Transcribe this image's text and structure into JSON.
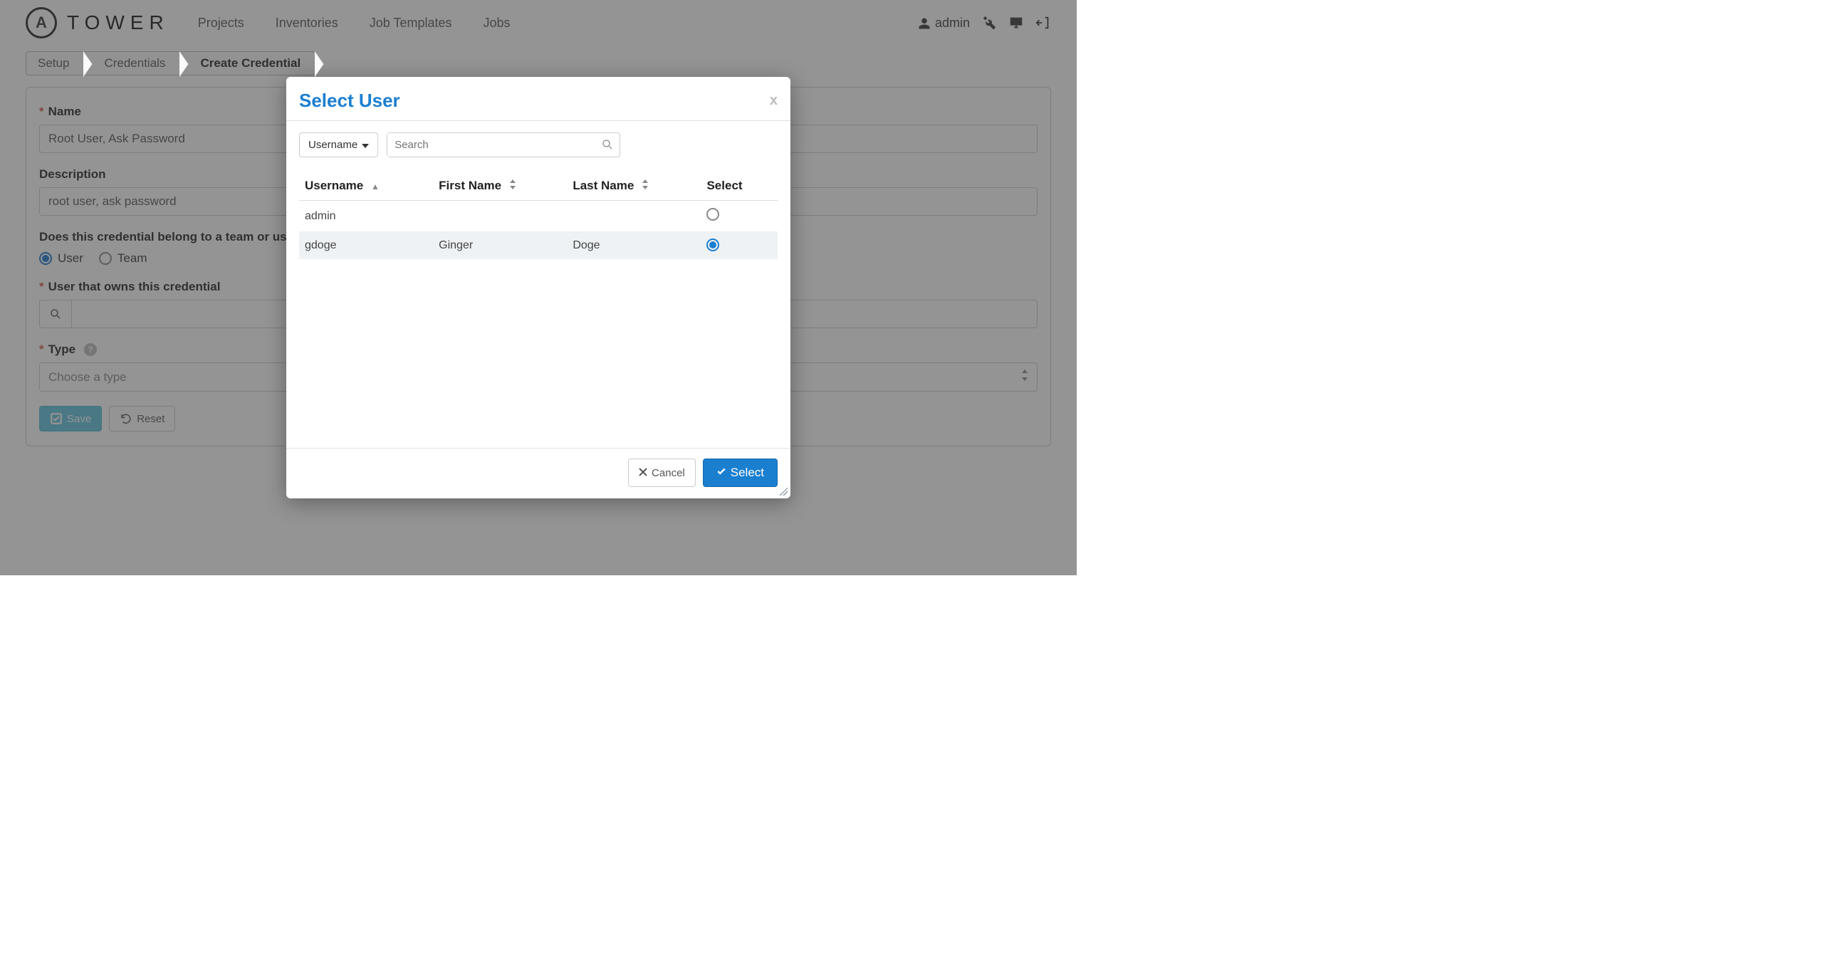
{
  "brand": {
    "badge": "A",
    "name": "TOWER"
  },
  "nav": {
    "links": [
      "Projects",
      "Inventories",
      "Job Templates",
      "Jobs"
    ],
    "user": "admin"
  },
  "breadcrumb": {
    "items": [
      {
        "label": "Setup",
        "active": false
      },
      {
        "label": "Credentials",
        "active": false
      },
      {
        "label": "Create Credential",
        "active": true
      }
    ]
  },
  "form": {
    "name_label": "Name",
    "name_value": "Root User, Ask Password",
    "desc_label": "Description",
    "desc_value": "root user, ask password",
    "owner_q": "Does this credential belong to a team or user?",
    "owner_options": {
      "user": "User",
      "team": "Team"
    },
    "user_label": "User that owns this credential",
    "type_label": "Type",
    "type_placeholder": "Choose a type",
    "save_label": "Save",
    "reset_label": "Reset"
  },
  "modal": {
    "title": "Select User",
    "filter_label": "Username",
    "search_placeholder": "Search",
    "columns": {
      "username": "Username",
      "first": "First Name",
      "last": "Last Name",
      "select": "Select"
    },
    "rows": [
      {
        "username": "admin",
        "first": "",
        "last": "",
        "selected": false
      },
      {
        "username": "gdoge",
        "first": "Ginger",
        "last": "Doge",
        "selected": true
      }
    ],
    "cancel_label": "Cancel",
    "select_label": "Select"
  }
}
